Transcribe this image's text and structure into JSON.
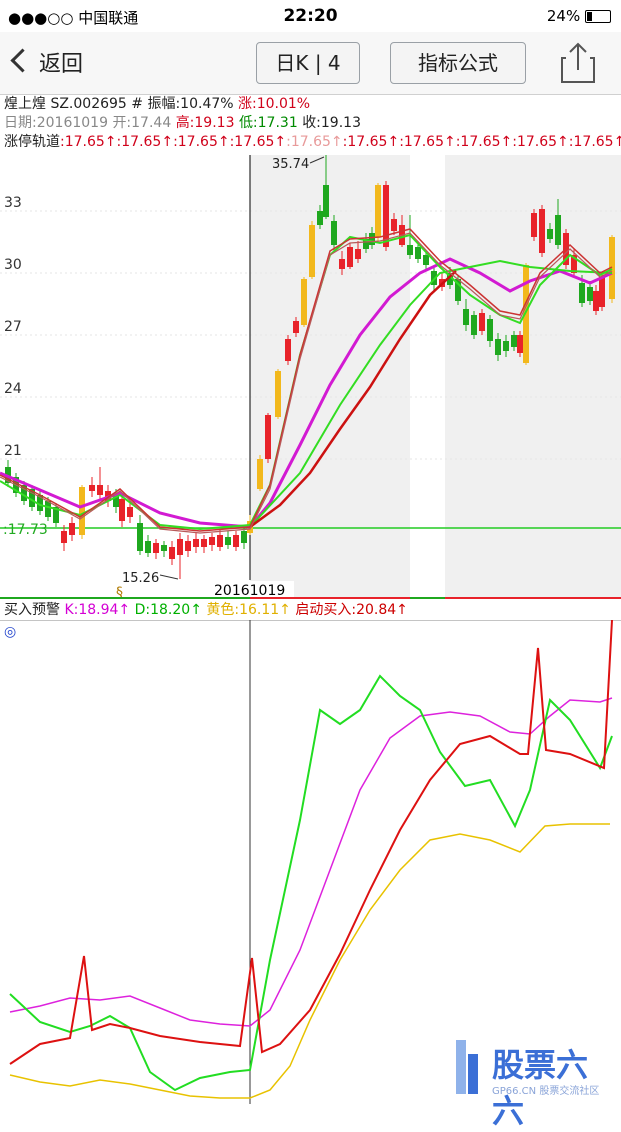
{
  "status": {
    "carrier": "●●●○○ 中国联通",
    "time": "22:20",
    "battery": "24%"
  },
  "nav": {
    "back": "返回",
    "period": "日K | 4",
    "formula": "指标公式"
  },
  "info": {
    "name": "煌上煌 SZ.002695",
    "amp_label": "# 振幅:10.47%",
    "chg_label": "涨:10.01%",
    "date": "日期:20161019",
    "open": "开:17.44",
    "high": "高:19.13",
    "low": "低:17.31",
    "close": "收:19.13",
    "rail_label": "涨停轨道",
    "rail_value": ":17.65↑"
  },
  "main_chart": {
    "y_ticks": [
      "33",
      "30",
      "27",
      "24",
      "21"
    ],
    "max_label": "35.74",
    "min_label": "15.26",
    "level_label": ":17.73",
    "date_label": "20161019",
    "marker": "§"
  },
  "indicator": {
    "title": "买入预警",
    "k": "K:18.94↑",
    "d": "D:18.20↑",
    "yellow": "黄色:16.11↑",
    "start": "启动买入:20.84↑",
    "circle": "◎"
  },
  "watermark": {
    "title": "股票六六",
    "sub": "GP66.CN 股票交流社区"
  },
  "colors": {
    "up": "#e8232a",
    "down": "#1fa81f",
    "yellow": "#f2b81c",
    "magenta": "#d21ad2",
    "green": "#33dd22",
    "darkred": "#cc1111",
    "bg_band": "#f0f0f0"
  }
}
